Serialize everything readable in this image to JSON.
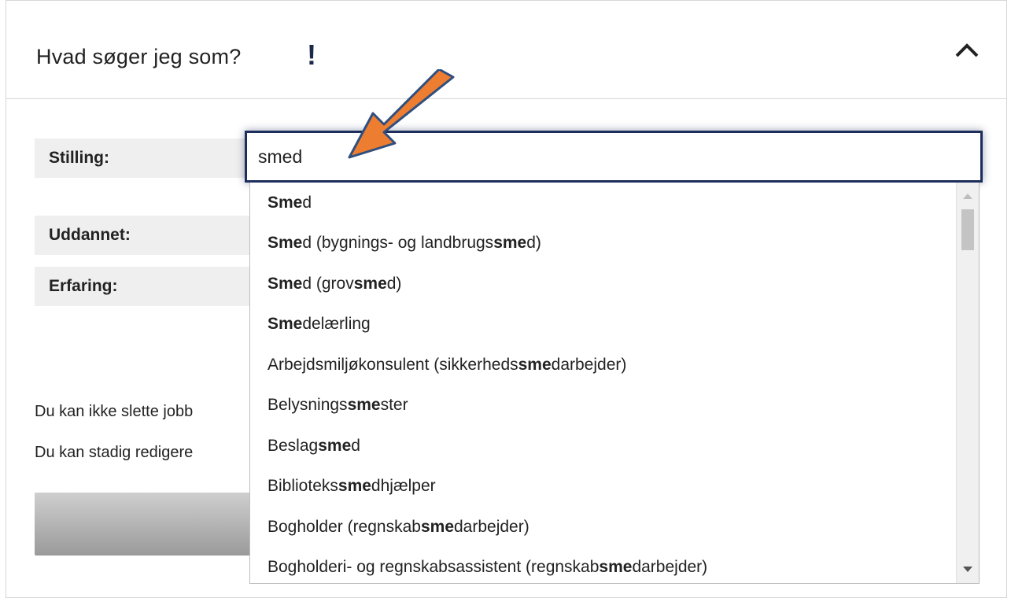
{
  "panel": {
    "title": "Hvad søger jeg som?",
    "warning_mark": "!"
  },
  "form": {
    "position_label": "Stilling:",
    "education_label": "Uddannet:",
    "experience_label": "Erfaring:",
    "search_value": "smed"
  },
  "info": {
    "line1": "Du kan ikke slette jobb",
    "line2": "Du kan stadig redigere"
  },
  "dropdown": {
    "highlight": "sme",
    "options": [
      {
        "pre": "",
        "match": "Sme",
        "post": "d"
      },
      {
        "pre": "",
        "match": "Sme",
        "post": "d (bygnings- og landbrugs",
        "match2": "sme",
        "post2": "d)"
      },
      {
        "pre": "",
        "match": "Sme",
        "post": "d (grov",
        "match2": "sme",
        "post2": "d)"
      },
      {
        "pre": "",
        "match": "Sme",
        "post": "delærling"
      },
      {
        "pre": "Arbejdsmiljøkonsulent (sikkerheds",
        "match": "sme",
        "post": "darbejder)"
      },
      {
        "pre": "Belysnings",
        "match": "sme",
        "post": "ster"
      },
      {
        "pre": "Beslag",
        "match": "sme",
        "post": "d"
      },
      {
        "pre": "Biblioteks",
        "match": "sme",
        "post": "dhjælper"
      },
      {
        "pre": "Bogholder (regnskab",
        "match": "sme",
        "post": "darbejder)"
      },
      {
        "pre": "Bogholderi- og regnskabsassistent (regnskab",
        "match": "sme",
        "post": "darbejder)"
      }
    ]
  },
  "colors": {
    "input_border": "#1d2e5c",
    "annotation_arrow": "#ed7d31"
  },
  "icons": {
    "collapse": "chevron-up-icon",
    "annotation": "arrow-annotation-icon"
  }
}
